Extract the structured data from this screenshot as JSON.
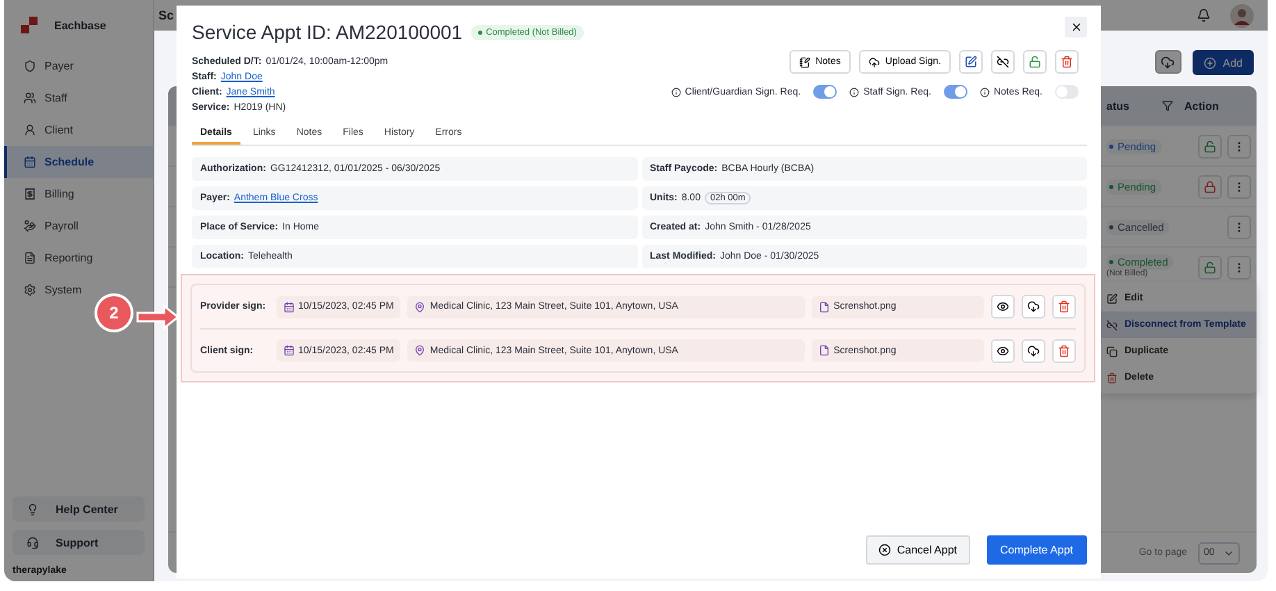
{
  "app": {
    "logo": "Eachbase",
    "page_title": "Sc",
    "brand": "therapylake"
  },
  "sidebar": {
    "items": [
      {
        "label": "Payer",
        "selected": false
      },
      {
        "label": "Staff",
        "selected": false
      },
      {
        "label": "Client",
        "selected": false
      },
      {
        "label": "Schedule",
        "selected": true
      },
      {
        "label": "Billing",
        "selected": false
      },
      {
        "label": "Payroll",
        "selected": false
      },
      {
        "label": "Reporting",
        "selected": false
      },
      {
        "label": "System",
        "selected": false
      }
    ],
    "footer": [
      "Help Center",
      "Support"
    ]
  },
  "toolbar": {
    "add_button": "Add"
  },
  "table": {
    "columns": [
      "atus",
      "Action"
    ],
    "rows": [
      {
        "status": "Pending",
        "kind": "info",
        "lock_button": true,
        "locked": false
      },
      {
        "status": "Pending",
        "kind": "success",
        "lock_button": true,
        "locked": true
      },
      {
        "status": "Cancelled",
        "kind": "neutral",
        "lock_button": false
      },
      {
        "status": "Completed",
        "note": "(Not Billed)",
        "kind": "success",
        "lock_button": true,
        "locked": false
      }
    ]
  },
  "context_menu": {
    "items": [
      {
        "label": "Edit",
        "selected": false
      },
      {
        "label": "Disconnect from Template",
        "selected": true
      },
      {
        "label": "Duplicate",
        "selected": false
      },
      {
        "label": "Delete",
        "selected": false
      }
    ]
  },
  "pagination": {
    "label": "Go to page",
    "value": "00"
  },
  "modal": {
    "title": "Service Appt ID: AM220100001",
    "status": "Completed (Not Billed)",
    "meta": [
      {
        "label": "Scheduled D/T:",
        "value": "01/01/24, 10:00am-12:00pm",
        "link": false
      },
      {
        "label": "Staff:",
        "value": "John Doe",
        "link": true
      },
      {
        "label": "Client:",
        "value": "Jane Smith",
        "link": true
      },
      {
        "label": "Service:",
        "value": "H2019 (HN)",
        "link": false
      }
    ],
    "actions": [
      "Notes",
      "Upload Sign."
    ],
    "toggles": [
      {
        "label": "Client/Guardian Sign. Req.",
        "on": true
      },
      {
        "label": "Staff Sign. Req.",
        "on": true
      },
      {
        "label": "Notes Req.",
        "on": false
      }
    ],
    "tabs": [
      {
        "label": "Details",
        "selected": true
      },
      {
        "label": "Links",
        "selected": false
      },
      {
        "label": "Notes",
        "selected": false
      },
      {
        "label": "Files",
        "selected": false
      },
      {
        "label": "History",
        "selected": false
      },
      {
        "label": "Errors",
        "selected": false
      }
    ],
    "details": [
      {
        "label": "Authorization:",
        "value": "GG12412312, 01/01/2025 - 06/30/2025",
        "link": false
      },
      {
        "label": "Staff Paycode:",
        "value": "BCBA Hourly (BCBA)",
        "link": false
      },
      {
        "label": "Payer:",
        "value": "Anthem Blue Cross",
        "link": true
      },
      {
        "label": "Units:",
        "value": "8.00",
        "badge": "02h 00m",
        "link": false
      },
      {
        "label": "Place of Service:",
        "value": "In Home",
        "link": false
      },
      {
        "label": "Created at:",
        "value": "John Smith - 01/28/2025",
        "link": false
      },
      {
        "label": "Location:",
        "value": "Telehealth",
        "link": false
      },
      {
        "label": "Last Modified:",
        "value": "John Doe - 01/30/2025",
        "link": false
      }
    ],
    "signatures": [
      {
        "label": "Provider sign:",
        "date": "10/15/2023, 02:45 PM",
        "location": "Medical Clinic, 123 Main Street, Suite 101, Anytown, USA",
        "file": "Screnshot.png"
      },
      {
        "label": "Client sign:",
        "date": "10/15/2023, 02:45 PM",
        "location": "Medical Clinic, 123 Main Street, Suite 101, Anytown, USA",
        "file": "Screnshot.png"
      }
    ],
    "footer": [
      "Cancel Appt",
      "Complete Appt"
    ]
  },
  "annotation": {
    "number": "2"
  }
}
